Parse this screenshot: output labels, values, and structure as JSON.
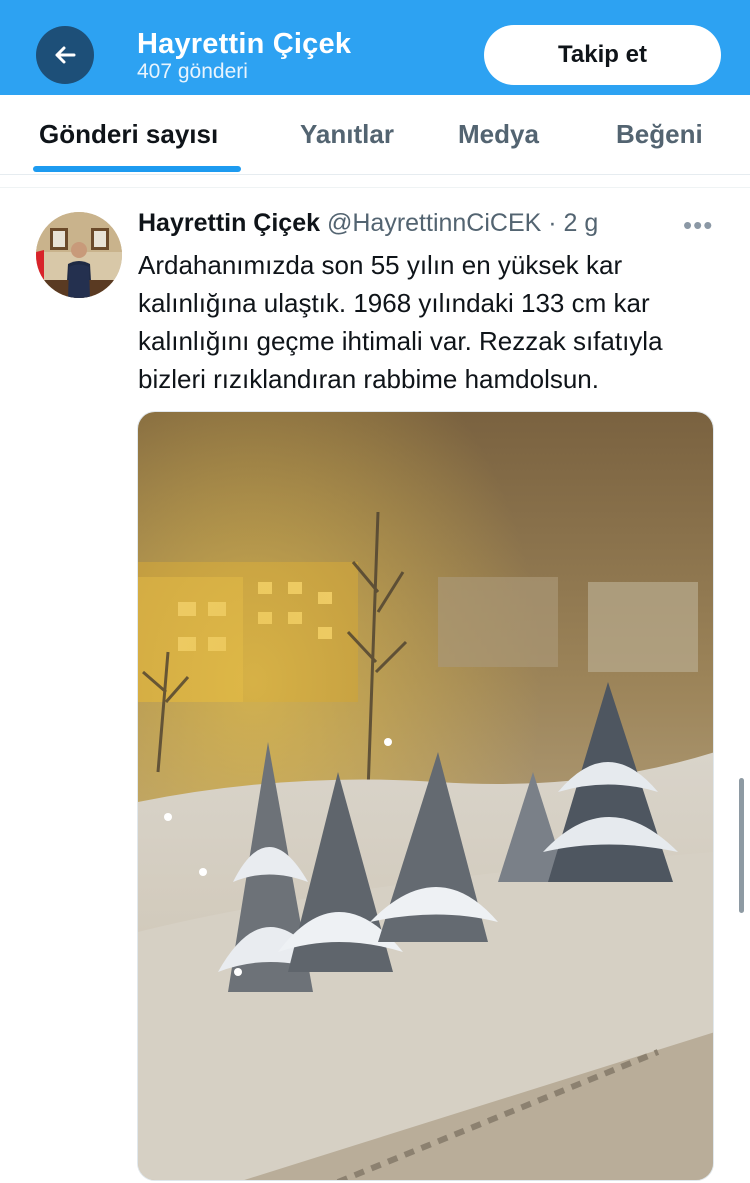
{
  "header": {
    "name": "Hayrettin Çiçek",
    "post_count": "407 gönderi",
    "follow_label": "Takip et",
    "bg_color": "#2da2f2"
  },
  "tabs": [
    {
      "label": "Gönderi sayısı",
      "active": true
    },
    {
      "label": "Yanıtlar",
      "active": false
    },
    {
      "label": "Medya",
      "active": false
    },
    {
      "label": "Beğeni",
      "active": false
    }
  ],
  "tweet": {
    "author_name": "Hayrettin Çiçek",
    "handle_time": "@HayrettinnCiCEK · 2 g",
    "more_icon": "more-horizontal-icon",
    "lines": [
      "Ardahanımızda son 55 yılın en yüksek kar",
      "kalınlığına ulaştık. 1968 yılındaki 133 cm kar",
      "kalınlığını geçme ihtimali var. Rezzak sıfatıyla",
      "bizleri rızıklandıran rabbime hamdolsun."
    ]
  },
  "icons": {
    "back": "arrow-left-icon"
  },
  "accent": "#1d9bf0"
}
